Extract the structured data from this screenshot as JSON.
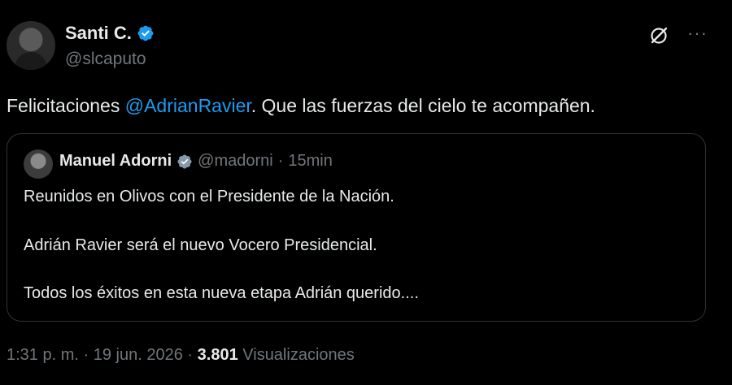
{
  "author": {
    "name": "Santi C.",
    "handle": "@slcaputo"
  },
  "tweet": {
    "text_before": "Felicitaciones ",
    "mention": "@AdrianRavier",
    "text_after": ". Que las fuerzas del cielo te acompañen."
  },
  "quote": {
    "name": "Manuel Adorni",
    "handle": "@madorni",
    "separator": "·",
    "time": "15min",
    "lines": [
      "Reunidos en Olivos con el Presidente de la Nación.",
      "Adrián Ravier será el nuevo Vocero Presidencial.",
      "Todos los éxitos en esta nueva etapa Adrián querido...."
    ]
  },
  "meta": {
    "time": "1:31 p. m.",
    "sep1": "·",
    "date": "19 jun. 2026",
    "sep2": "·",
    "views_count": "3.801",
    "views_label": "Visualizaciones"
  },
  "colors": {
    "background": "#000000",
    "text": "#e7e9ea",
    "secondary": "#71767b",
    "accent": "#1d9bf0",
    "border": "#2f3336"
  },
  "icons": [
    "verified-badge-icon",
    "grok-icon",
    "more-icon"
  ]
}
